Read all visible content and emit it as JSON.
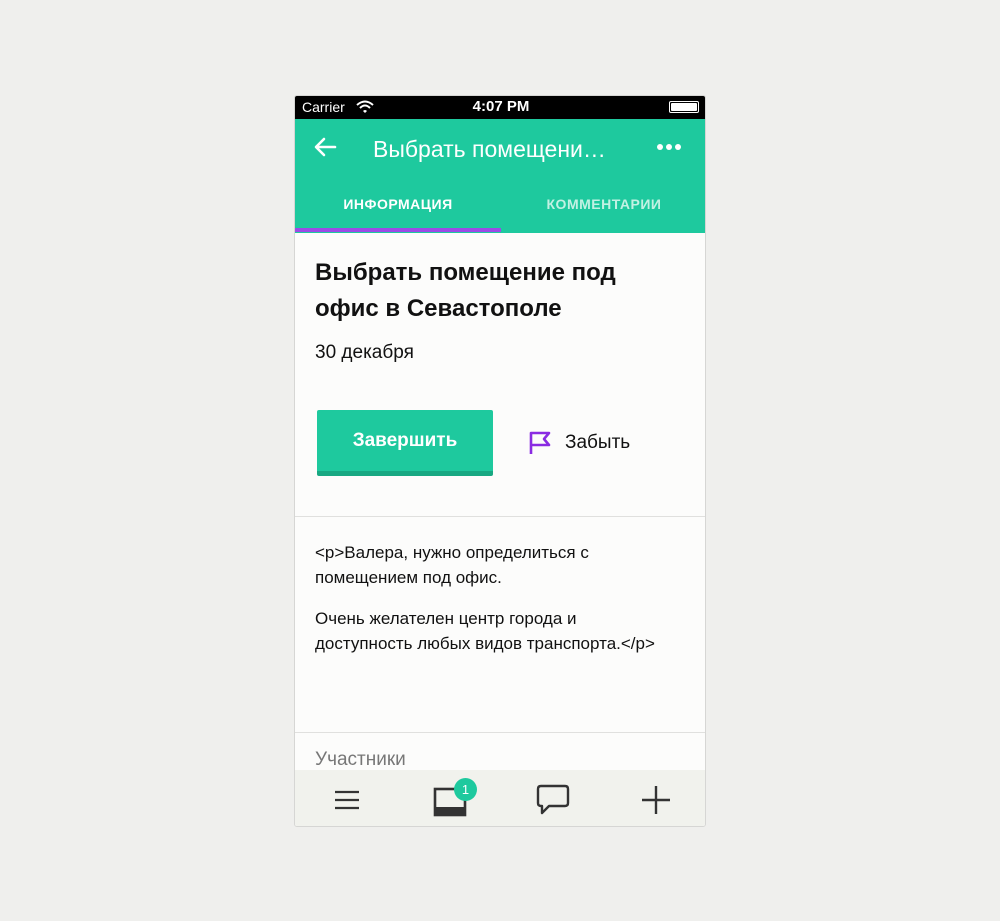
{
  "status_bar": {
    "carrier": "Carrier",
    "time": "4:07 PM"
  },
  "header": {
    "title": "Выбрать помещени…",
    "tabs": [
      {
        "label": "ИНФОРМАЦИЯ",
        "active": true
      },
      {
        "label": "КОММЕНТАРИИ",
        "active": false
      }
    ]
  },
  "task": {
    "title": "Выбрать помещение под офис в Севастополе",
    "date": "30 декабря",
    "complete_label": "Завершить",
    "forget_label": "Забыть",
    "description": [
      "<p>Валера, нужно определиться с помещением под офис.",
      "Очень желателен центр города и доступность любых видов транспорта.</p>"
    ],
    "participants_label": "Участники"
  },
  "tabbar": {
    "items": [
      {
        "icon": "menu-icon"
      },
      {
        "icon": "inbox-icon",
        "badge": "1"
      },
      {
        "icon": "chat-icon"
      },
      {
        "icon": "plus-icon"
      }
    ]
  },
  "colors": {
    "accent": "#1ec99e",
    "tab_indicator": "#9b4be6",
    "flag": "#8a2be2"
  }
}
